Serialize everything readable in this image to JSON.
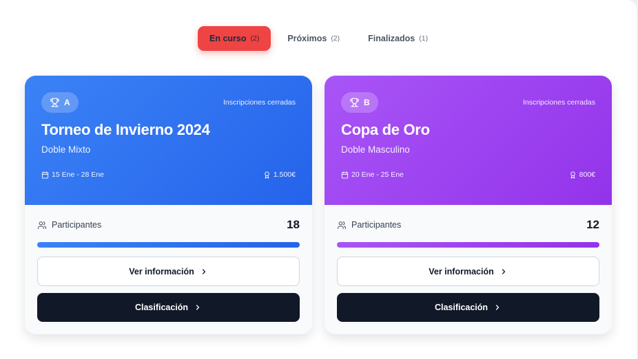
{
  "tabs": [
    {
      "label": "En curso",
      "count": "(2)",
      "active": true
    },
    {
      "label": "Próximos",
      "count": "(2)",
      "active": false
    },
    {
      "label": "Finalizados",
      "count": "(1)",
      "active": false
    }
  ],
  "cards": [
    {
      "badge": "A",
      "status": "Inscripciones cerradas",
      "title": "Torneo de Invierno 2024",
      "subtitle": "Doble Mixto",
      "dates": "15 Ene - 28 Ene",
      "prize": "1.500€",
      "participants_label": "Participantes",
      "participants": "18",
      "info_button": "Ver información",
      "rank_button": "Clasificación",
      "accent": "#3b82f6"
    },
    {
      "badge": "B",
      "status": "Inscripciones cerradas",
      "title": "Copa de Oro",
      "subtitle": "Doble Masculino",
      "dates": "20 Ene - 25 Ene",
      "prize": "800€",
      "participants_label": "Participantes",
      "participants": "12",
      "info_button": "Ver información",
      "rank_button": "Clasificación",
      "accent": "#a855f7"
    }
  ],
  "icons": {
    "badge": "trophy-icon",
    "dates": "calendar-icon",
    "prize": "medal-icon",
    "participants": "users-icon",
    "button_arrow": "chevron-right-icon"
  }
}
